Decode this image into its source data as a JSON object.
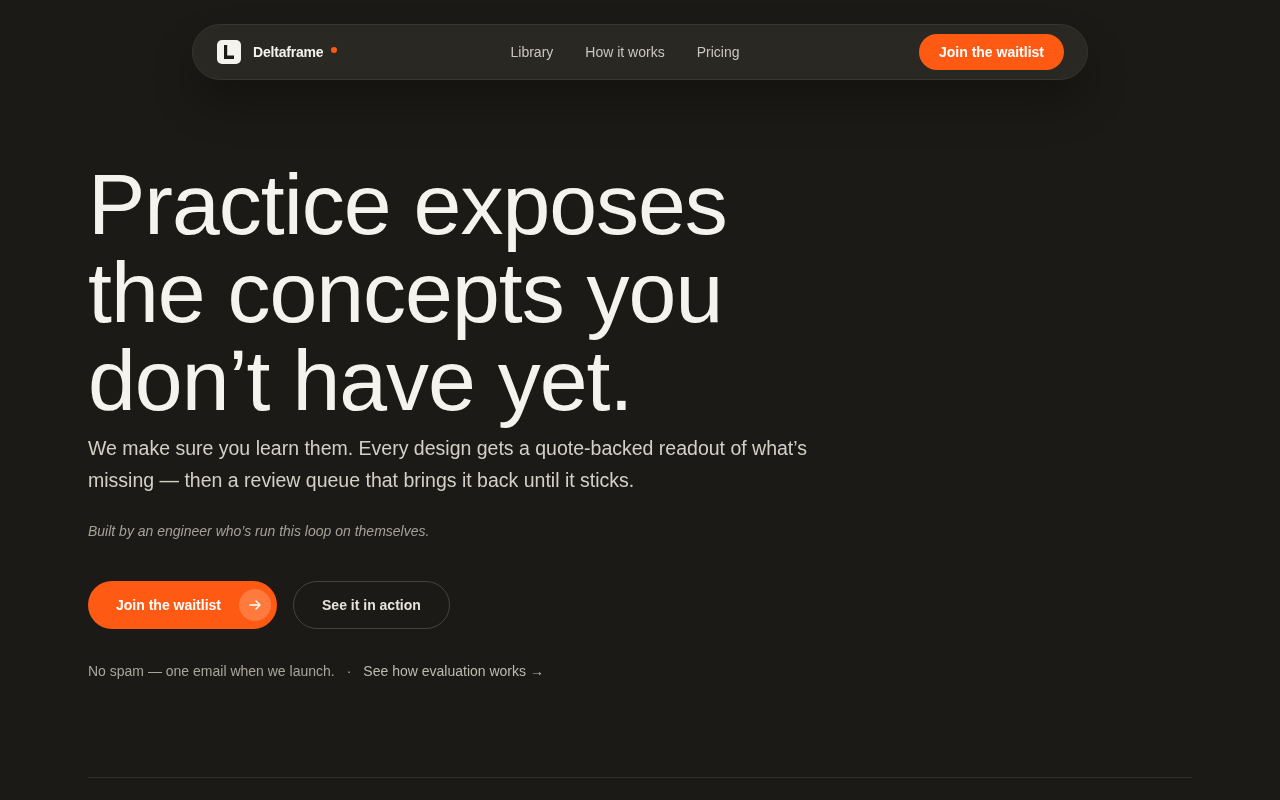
{
  "navbar": {
    "brand": "Deltaframe",
    "links": [
      {
        "label": "Library"
      },
      {
        "label": "How it works"
      },
      {
        "label": "Pricing"
      }
    ],
    "cta": "Join the waitlist"
  },
  "hero": {
    "heading": "Practice exposes the concepts you don’t have yet.",
    "lead": "We make sure you learn them. Every design gets a quote-backed readout of what’s missing — then a review queue that brings it back until it sticks.",
    "note": "Built by an engineer who’s run this loop on themselves.",
    "buttons": [
      {
        "label": "Join the waitlist",
        "kind": "primary"
      },
      {
        "label": "See it in action",
        "kind": "secondary"
      }
    ],
    "footnote": "No spam — one email when we launch.",
    "separator": "·",
    "link": "See how evaluation works →"
  }
}
